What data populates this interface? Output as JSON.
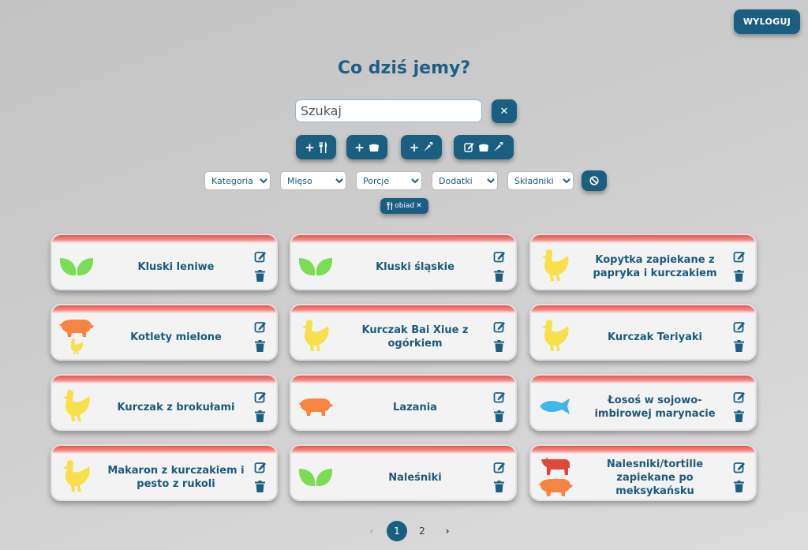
{
  "header": {
    "logout_label": "WYLOGUJ"
  },
  "page": {
    "title": "Co dziś jemy?"
  },
  "search": {
    "placeholder": "Szukaj",
    "clear_label": "✕"
  },
  "add_buttons": [
    {
      "plus": "+",
      "icon": "fork-knife-icon"
    },
    {
      "plus": "+",
      "icon": "bowl-icon"
    },
    {
      "plus": "+",
      "icon": "carrot-icon"
    },
    {
      "plus": "",
      "icon": "edit-bowl-carrot-icon"
    }
  ],
  "filters": [
    {
      "name": "kategoria",
      "selected": "Kategoria"
    },
    {
      "name": "mieso",
      "selected": "Mięso"
    },
    {
      "name": "porcje",
      "selected": "Porcje"
    },
    {
      "name": "dodatki",
      "selected": "Dodatki"
    },
    {
      "name": "skladniki",
      "selected": "Składniki"
    }
  ],
  "active_filter_chip": {
    "label": "obiad",
    "close": "✕"
  },
  "colors": {
    "accent": "#1b5f80",
    "card_top": "#ea5550",
    "leaf": "#7bdc56",
    "chicken": "#f8e04a",
    "pig": "#f58540",
    "cow": "#e0483a",
    "fish": "#3fb7e8"
  },
  "recipes": [
    {
      "name": "Kluski leniwe",
      "icons": [
        "leaf"
      ]
    },
    {
      "name": "Kluski śląskie",
      "icons": [
        "leaf"
      ]
    },
    {
      "name": "Kopytka zapiekane z papryka i kurczakiem",
      "icons": [
        "chicken"
      ]
    },
    {
      "name": "Kotlety mielone",
      "icons": [
        "pig",
        "chicken-small"
      ]
    },
    {
      "name": "Kurczak Bai Xiue z ogórkiem",
      "icons": [
        "chicken"
      ]
    },
    {
      "name": "Kurczak Teriyaki",
      "icons": [
        "chicken"
      ]
    },
    {
      "name": "Kurczak z brokułami",
      "icons": [
        "chicken"
      ]
    },
    {
      "name": "Lazania",
      "icons": [
        "pig"
      ]
    },
    {
      "name": "Łosoś w sojowo-imbirowej marynacie",
      "icons": [
        "fish"
      ]
    },
    {
      "name": "Makaron z kurczakiem i pesto z rukoli",
      "icons": [
        "chicken"
      ]
    },
    {
      "name": "Naleśniki",
      "icons": [
        "leaf"
      ]
    },
    {
      "name": "Nalesniki/tortille zapiekane po meksykańsku",
      "icons": [
        "cow",
        "pig"
      ]
    }
  ],
  "pagination": {
    "prev": "‹",
    "pages": [
      "1",
      "2"
    ],
    "current": "1",
    "next": "›"
  }
}
